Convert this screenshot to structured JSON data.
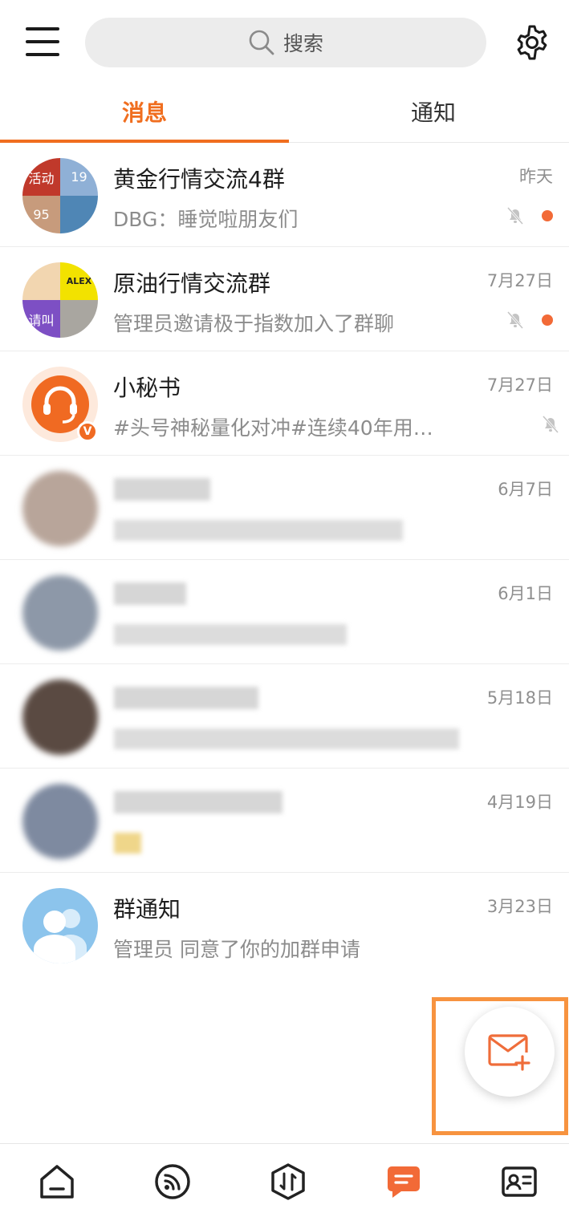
{
  "search": {
    "placeholder": "搜索"
  },
  "tabs": [
    {
      "label": "消息",
      "active": true
    },
    {
      "label": "通知",
      "active": false
    }
  ],
  "colors": {
    "accent": "#f06e1f",
    "unread_dot": "#f26a37",
    "fab_highlight": "#f7933f"
  },
  "conversations": [
    {
      "title": "黄金行情交流4群",
      "preview": "DBG：睡觉啦朋友们",
      "time": "昨天",
      "muted": true,
      "unread": true,
      "avatar_tiles": [
        "活动",
        "19",
        "95",
        ""
      ]
    },
    {
      "title": "原油行情交流群",
      "preview": "管理员邀请极于指数加入了群聊",
      "time": "7月27日",
      "muted": true,
      "unread": true,
      "avatar_tiles": [
        "",
        "ALEX",
        "请叫",
        ""
      ]
    },
    {
      "title": "小秘书",
      "preview": "#头号神秘量化对冲#连续40年用…",
      "time": "7月27日",
      "muted": true,
      "unread": false,
      "verified_badge": "V"
    },
    {
      "title": "",
      "preview": "",
      "time": "6月7日",
      "blurred": true
    },
    {
      "title": "",
      "preview": "",
      "time": "6月1日",
      "blurred": true
    },
    {
      "title": "",
      "preview": "",
      "time": "5月18日",
      "blurred": true
    },
    {
      "title": "",
      "preview": "",
      "time": "4月19日",
      "blurred": true
    },
    {
      "title": "群通知",
      "preview": "管理员 同意了你的加群申请",
      "time": "3月23日",
      "muted": false,
      "unread": false
    }
  ],
  "icons": {
    "menu": "hamburger-icon",
    "search": "search-icon",
    "settings": "gear-icon",
    "compose": "mail-plus-icon",
    "nav": [
      "home-icon",
      "rss-icon",
      "trade-icon",
      "chat-icon",
      "contact-card-icon"
    ]
  },
  "bottom_nav": {
    "active_index": 3
  }
}
